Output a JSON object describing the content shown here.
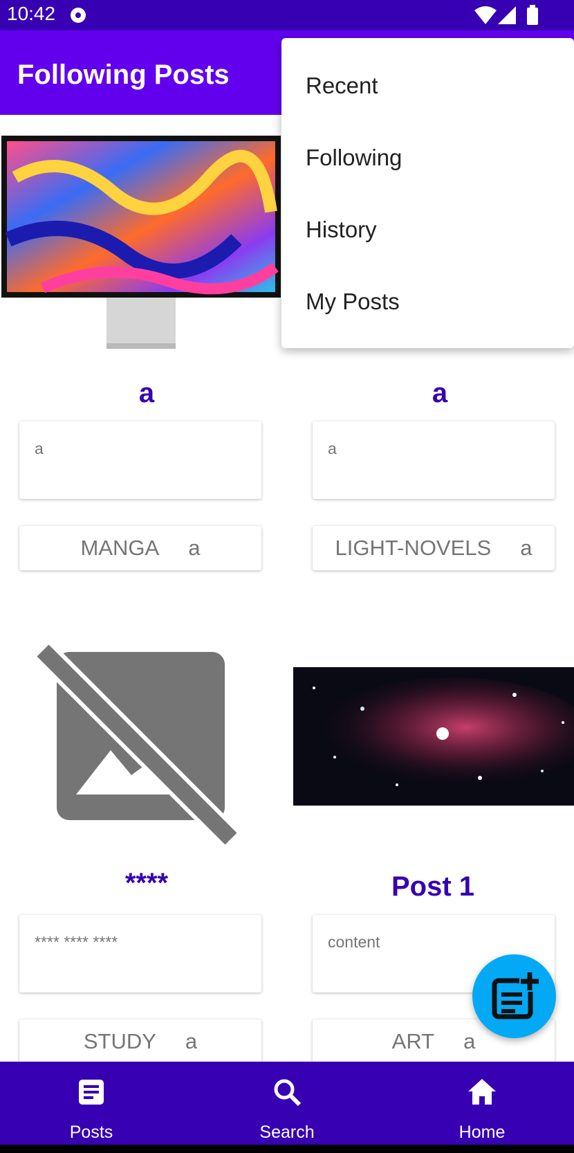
{
  "status": {
    "time": "10:42"
  },
  "app_bar": {
    "title": "Following Posts"
  },
  "menu": {
    "items": [
      "Recent",
      "Following",
      "History",
      "My Posts"
    ]
  },
  "posts": [
    {
      "title": "a",
      "content": "a",
      "category": "MANGA",
      "author": "a",
      "image": "monitor"
    },
    {
      "title": "a",
      "content": "a",
      "category": "LIGHT-NOVELS",
      "author": "a",
      "image": "none"
    },
    {
      "title": "****",
      "content": "**** **** ****",
      "category": "STUDY",
      "author": "a",
      "image": "image-off-icon"
    },
    {
      "title": "Post 1",
      "content": "content",
      "category": "ART",
      "author": "a",
      "image": "space-nebula"
    }
  ],
  "fab": {
    "icon": "new-post-icon"
  },
  "bottom_nav": [
    {
      "label": "Posts",
      "icon": "posts-icon"
    },
    {
      "label": "Search",
      "icon": "search-icon"
    },
    {
      "label": "Home",
      "icon": "home-icon"
    }
  ],
  "colors": {
    "primary": "#6200ee",
    "primary_dark": "#3700b3",
    "accent": "#03a9f4"
  }
}
